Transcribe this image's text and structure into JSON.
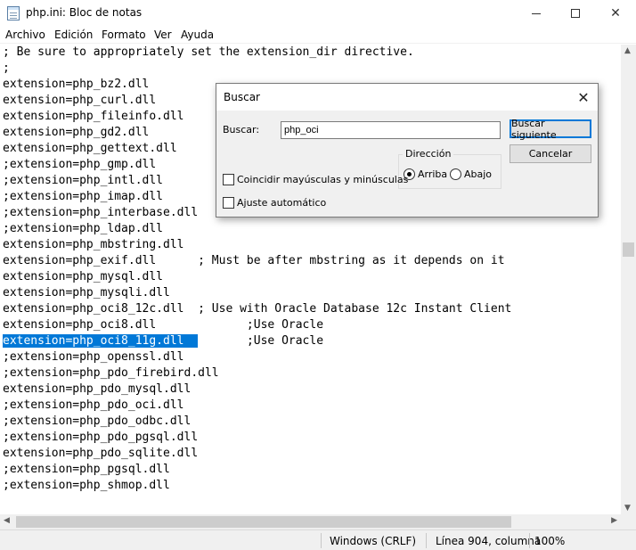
{
  "window": {
    "title": "php.ini: Bloc de notas",
    "minimize_icon": "minimize-icon",
    "maximize_icon": "maximize-icon",
    "close_glyph": "✕"
  },
  "menu": [
    "Archivo",
    "Edición",
    "Formato",
    "Ver",
    "Ayuda"
  ],
  "editor": {
    "lines": [
      "; Be sure to appropriately set the extension_dir directive.",
      ";",
      "extension=php_bz2.dll",
      "extension=php_curl.dll",
      "extension=php_fileinfo.dll",
      "extension=php_gd2.dll",
      "extension=php_gettext.dll",
      ";extension=php_gmp.dll",
      ";extension=php_intl.dll",
      ";extension=php_imap.dll",
      ";extension=php_interbase.dll",
      ";extension=php_ldap.dll",
      "extension=php_mbstring.dll",
      "extension=php_exif.dll      ; Must be after mbstring as it depends on it",
      "extension=php_mysql.dll",
      "extension=php_mysqli.dll",
      "extension=php_oci8_12c.dll  ; Use with Oracle Database 12c Instant Client",
      "extension=php_oci8.dll             ;Use Oracle",
      "extension=php_oci8_11g.dll         ;Use Oracle",
      ";extension=php_openssl.dll",
      ";extension=php_pdo_firebird.dll",
      "extension=php_pdo_mysql.dll",
      ";extension=php_pdo_oci.dll",
      ";extension=php_pdo_odbc.dll",
      ";extension=php_pdo_pgsql.dll",
      "extension=php_pdo_sqlite.dll",
      ";extension=php_pgsql.dll",
      ";extension=php_shmop.dll"
    ],
    "selected_line": {
      "selected": "extension=php_oci8_11g.dll  ",
      "rest": "       ;Use Oracle"
    }
  },
  "find_dialog": {
    "title": "Buscar",
    "close_glyph": "✕",
    "search_label": "Buscar:",
    "search_value": "php_oci",
    "find_next_label": "Buscar siguiente",
    "cancel_label": "Cancelar",
    "direction_label": "Dirección",
    "up_label": "Arriba",
    "down_label": "Abajo",
    "match_case_label": "Coincidir mayúsculas y minúsculas",
    "wrap_label": "Ajuste automático",
    "direction_selected": "up",
    "match_case_checked": false,
    "wrap_checked": false
  },
  "scrollbars": {
    "up_arrow": "▲",
    "down_arrow": "▼",
    "left_arrow": "◀",
    "right_arrow": "▶"
  },
  "statusbar": {
    "line_ending": "Windows (CRLF)",
    "position": "Línea 904, columna",
    "zoom": "100%"
  }
}
